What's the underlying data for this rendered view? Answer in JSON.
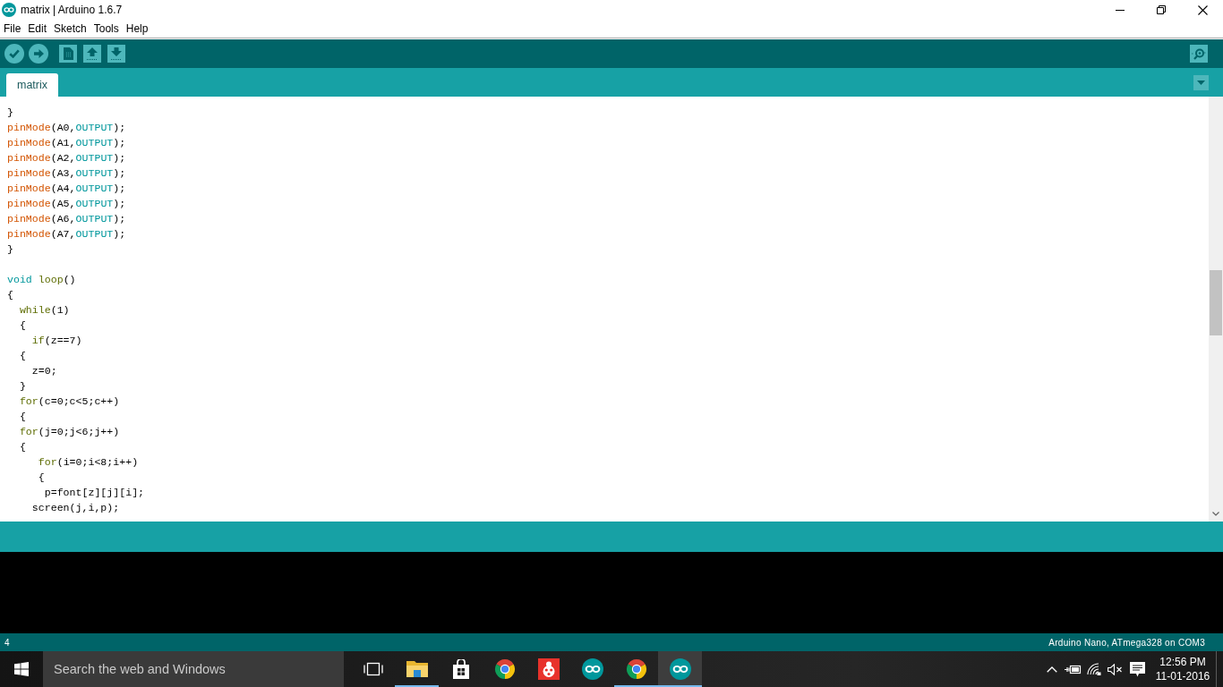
{
  "window": {
    "title": "matrix | Arduino 1.6.7"
  },
  "menu": [
    "File",
    "Edit",
    "Sketch",
    "Tools",
    "Help"
  ],
  "tabs": [
    {
      "label": "matrix",
      "selected": true
    }
  ],
  "editor": {
    "blocks": [
      {
        "lines": [
          {
            "tokens": [
              {
                "kind": "plain",
                "text": "}"
              }
            ]
          },
          {
            "tokens": [
              {
                "kind": "function",
                "text": "pinMode"
              },
              {
                "kind": "plain",
                "text": "(A0,"
              },
              {
                "kind": "constant",
                "text": "OUTPUT"
              },
              {
                "kind": "plain",
                "text": ");"
              }
            ]
          },
          {
            "tokens": [
              {
                "kind": "function",
                "text": "pinMode"
              },
              {
                "kind": "plain",
                "text": "(A1,"
              },
              {
                "kind": "constant",
                "text": "OUTPUT"
              },
              {
                "kind": "plain",
                "text": ");"
              }
            ]
          },
          {
            "tokens": [
              {
                "kind": "function",
                "text": "pinMode"
              },
              {
                "kind": "plain",
                "text": "(A2,"
              },
              {
                "kind": "constant",
                "text": "OUTPUT"
              },
              {
                "kind": "plain",
                "text": ");"
              }
            ]
          },
          {
            "tokens": [
              {
                "kind": "function",
                "text": "pinMode"
              },
              {
                "kind": "plain",
                "text": "(A3,"
              },
              {
                "kind": "constant",
                "text": "OUTPUT"
              },
              {
                "kind": "plain",
                "text": ");"
              }
            ]
          },
          {
            "tokens": [
              {
                "kind": "function",
                "text": "pinMode"
              },
              {
                "kind": "plain",
                "text": "(A4,"
              },
              {
                "kind": "constant",
                "text": "OUTPUT"
              },
              {
                "kind": "plain",
                "text": ");"
              }
            ]
          },
          {
            "tokens": [
              {
                "kind": "function",
                "text": "pinMode"
              },
              {
                "kind": "plain",
                "text": "(A5,"
              },
              {
                "kind": "constant",
                "text": "OUTPUT"
              },
              {
                "kind": "plain",
                "text": ");"
              }
            ]
          },
          {
            "tokens": [
              {
                "kind": "function",
                "text": "pinMode"
              },
              {
                "kind": "plain",
                "text": "(A6,"
              },
              {
                "kind": "constant",
                "text": "OUTPUT"
              },
              {
                "kind": "plain",
                "text": ");"
              }
            ]
          },
          {
            "tokens": [
              {
                "kind": "function",
                "text": "pinMode"
              },
              {
                "kind": "plain",
                "text": "(A7,"
              },
              {
                "kind": "constant",
                "text": "OUTPUT"
              },
              {
                "kind": "plain",
                "text": ");"
              }
            ]
          },
          {
            "tokens": [
              {
                "kind": "plain",
                "text": "}"
              }
            ]
          }
        ]
      },
      {
        "lines": [
          {
            "tokens": [
              {
                "kind": "type",
                "text": "void"
              },
              {
                "kind": "keyword",
                "text": " loop"
              },
              {
                "kind": "plain",
                "text": "()"
              }
            ]
          },
          {
            "tokens": [
              {
                "kind": "plain",
                "text": "{"
              }
            ]
          },
          {
            "tokens": [
              {
                "kind": "keyword",
                "text": "  while"
              },
              {
                "kind": "plain",
                "text": "(1)"
              }
            ]
          },
          {
            "tokens": [
              {
                "kind": "plain",
                "text": "  {"
              }
            ]
          },
          {
            "tokens": [
              {
                "kind": "keyword",
                "text": "    if"
              },
              {
                "kind": "plain",
                "text": "(z==7)"
              }
            ]
          },
          {
            "tokens": [
              {
                "kind": "plain",
                "text": "  {"
              }
            ]
          },
          {
            "tokens": [
              {
                "kind": "plain",
                "text": "    z=0;"
              }
            ]
          },
          {
            "tokens": [
              {
                "kind": "plain",
                "text": "  }"
              }
            ]
          },
          {
            "tokens": [
              {
                "kind": "keyword",
                "text": "  for"
              },
              {
                "kind": "plain",
                "text": "(c=0;c<5;c++)"
              }
            ]
          },
          {
            "tokens": [
              {
                "kind": "plain",
                "text": "  {"
              }
            ]
          },
          {
            "tokens": [
              {
                "kind": "keyword",
                "text": "  for"
              },
              {
                "kind": "plain",
                "text": "(j=0;j<6;j++)"
              }
            ]
          },
          {
            "tokens": [
              {
                "kind": "plain",
                "text": "  {"
              }
            ]
          },
          {
            "tokens": [
              {
                "kind": "keyword",
                "text": "     for"
              },
              {
                "kind": "plain",
                "text": "(i=0;i<8;i++)"
              }
            ]
          },
          {
            "tokens": [
              {
                "kind": "plain",
                "text": "     {"
              }
            ]
          },
          {
            "tokens": [
              {
                "kind": "plain",
                "text": "      p=font[z][j][i];"
              }
            ]
          },
          {
            "tokens": [
              {
                "kind": "plain",
                "text": "    screen(j,i,p);"
              }
            ]
          }
        ]
      }
    ]
  },
  "status_bar": {
    "line": "4",
    "board": "Arduino Nano, ATmega328 on COM3"
  },
  "taskbar": {
    "search": {
      "placeholder": "Search the web and Windows"
    },
    "apps": [
      {
        "kind": "folder",
        "running": true,
        "selected": false
      },
      {
        "kind": "bag",
        "running": false,
        "selected": false
      },
      {
        "kind": "browser",
        "running": false,
        "selected": false
      },
      {
        "kind": "ladybug",
        "running": false,
        "selected": false
      },
      {
        "kind": "infinity",
        "running": false,
        "selected": false
      },
      {
        "kind": "browser",
        "running": true,
        "selected": false
      },
      {
        "kind": "infinity",
        "running": true,
        "selected": true
      }
    ],
    "clock": {
      "time": "12:56 PM",
      "date": "11-01-2016"
    }
  }
}
